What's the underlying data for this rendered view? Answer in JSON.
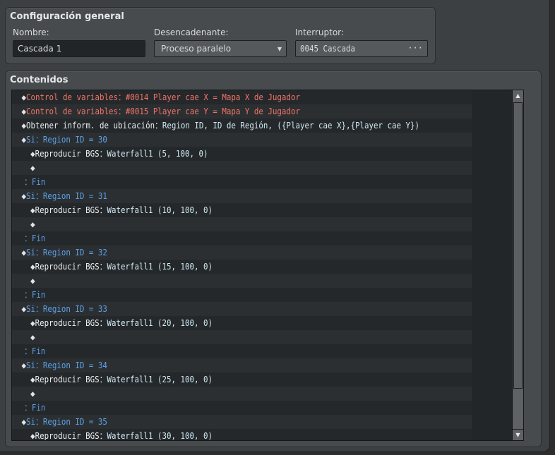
{
  "general": {
    "title": "Configuración general",
    "name_label": "Nombre:",
    "name_value": "Cascada 1",
    "trigger_label": "Desencadenante:",
    "trigger_value": "Proceso paralelo",
    "switch_label": "Interruptor:",
    "switch_value": "0045 Cascada",
    "switch_button": "···"
  },
  "contents": {
    "title": "Contenidos",
    "rows": [
      {
        "indent": 0,
        "diamond": "◆",
        "parts": [
          [
            "red",
            "Control de variables："
          ],
          [
            "red",
            "#0014 Player cae X = Mapa X de Jugador"
          ]
        ]
      },
      {
        "indent": 0,
        "diamond": "◆",
        "parts": [
          [
            "red",
            "Control de variables："
          ],
          [
            "red",
            "#0015 Player cae Y = Mapa Y de Jugador"
          ]
        ]
      },
      {
        "indent": 0,
        "diamond": "◆",
        "parts": [
          [
            "wht",
            "Obtener inform. de ubicación："
          ],
          [
            "prm",
            "Region ID, ID de Región, ({Player cae X},{Player cae Y})"
          ]
        ]
      },
      {
        "indent": 0,
        "diamond": "◆",
        "parts": [
          [
            "blue",
            "Si："
          ],
          [
            "blue",
            "Region ID = 30"
          ]
        ]
      },
      {
        "indent": 1,
        "diamond": "◆",
        "parts": [
          [
            "wht",
            "Reproducir BGS："
          ],
          [
            "prm",
            "Waterfall1 (5, 100, 0)"
          ]
        ]
      },
      {
        "indent": 1,
        "diamond": "◆",
        "parts": []
      },
      {
        "indent": 0,
        "diamond": "",
        "parts": [
          [
            "blue",
            "：Fin"
          ]
        ]
      },
      {
        "indent": 0,
        "diamond": "◆",
        "parts": [
          [
            "blue",
            "Si："
          ],
          [
            "blue",
            "Region ID = 31"
          ]
        ]
      },
      {
        "indent": 1,
        "diamond": "◆",
        "parts": [
          [
            "wht",
            "Reproducir BGS："
          ],
          [
            "prm",
            "Waterfall1 (10, 100, 0)"
          ]
        ]
      },
      {
        "indent": 1,
        "diamond": "◆",
        "parts": []
      },
      {
        "indent": 0,
        "diamond": "",
        "parts": [
          [
            "blue",
            "：Fin"
          ]
        ]
      },
      {
        "indent": 0,
        "diamond": "◆",
        "parts": [
          [
            "blue",
            "Si："
          ],
          [
            "blue",
            "Region ID = 32"
          ]
        ]
      },
      {
        "indent": 1,
        "diamond": "◆",
        "parts": [
          [
            "wht",
            "Reproducir BGS："
          ],
          [
            "prm",
            "Waterfall1 (15, 100, 0)"
          ]
        ]
      },
      {
        "indent": 1,
        "diamond": "◆",
        "parts": []
      },
      {
        "indent": 0,
        "diamond": "",
        "parts": [
          [
            "blue",
            "：Fin"
          ]
        ]
      },
      {
        "indent": 0,
        "diamond": "◆",
        "parts": [
          [
            "blue",
            "Si："
          ],
          [
            "blue",
            "Region ID = 33"
          ]
        ]
      },
      {
        "indent": 1,
        "diamond": "◆",
        "parts": [
          [
            "wht",
            "Reproducir BGS："
          ],
          [
            "prm",
            "Waterfall1 (20, 100, 0)"
          ]
        ]
      },
      {
        "indent": 1,
        "diamond": "◆",
        "parts": []
      },
      {
        "indent": 0,
        "diamond": "",
        "parts": [
          [
            "blue",
            "：Fin"
          ]
        ]
      },
      {
        "indent": 0,
        "diamond": "◆",
        "parts": [
          [
            "blue",
            "Si："
          ],
          [
            "blue",
            "Region ID = 34"
          ]
        ]
      },
      {
        "indent": 1,
        "diamond": "◆",
        "parts": [
          [
            "wht",
            "Reproducir BGS："
          ],
          [
            "prm",
            "Waterfall1 (25, 100, 0)"
          ]
        ]
      },
      {
        "indent": 1,
        "diamond": "◆",
        "parts": []
      },
      {
        "indent": 0,
        "diamond": "",
        "parts": [
          [
            "blue",
            "：Fin"
          ]
        ]
      },
      {
        "indent": 0,
        "diamond": "◆",
        "parts": [
          [
            "blue",
            "Si："
          ],
          [
            "blue",
            "Region ID = 35"
          ]
        ]
      },
      {
        "indent": 1,
        "diamond": "◆",
        "parts": [
          [
            "wht",
            "Reproducir BGS："
          ],
          [
            "prm",
            "Waterfall1 (30, 100, 0)"
          ]
        ]
      }
    ]
  },
  "icons": {
    "dropdown": "▼",
    "scroll_up": "▲",
    "scroll_down": "▼"
  }
}
